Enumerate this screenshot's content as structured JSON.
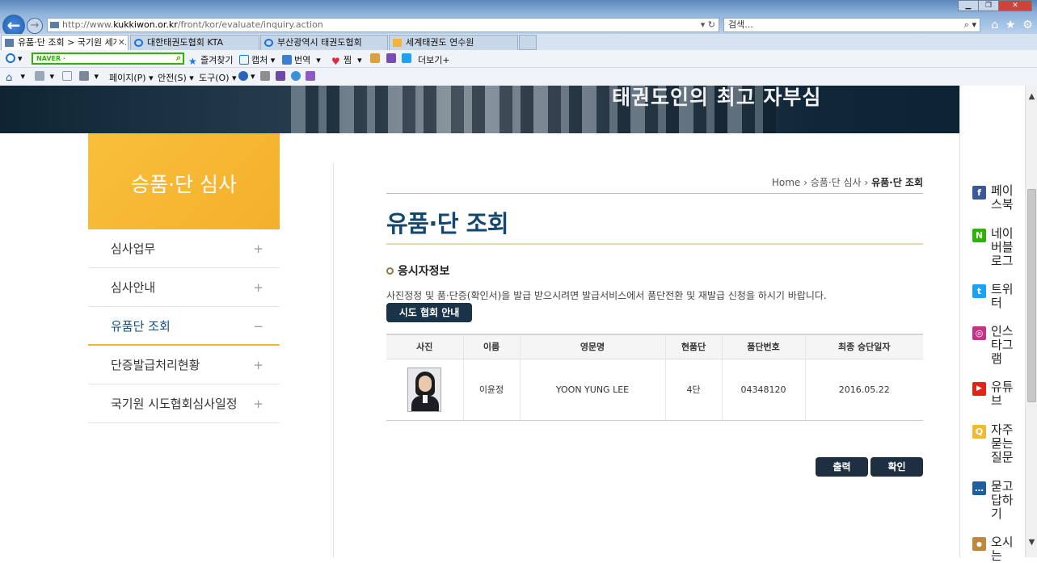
{
  "browser": {
    "address_prefix": "http://www.",
    "address_host": "kukkiwon.or.kr",
    "address_path": "/front/kor/evaluate/inquiry.action",
    "search_placeholder": "검색...",
    "tabs": [
      {
        "label": "유품·단 조회 > 국기원 세계..."
      },
      {
        "label": "대한태권도협회 KTA"
      },
      {
        "label": "부산광역시 태권도협회"
      },
      {
        "label": "세계태권도 연수원"
      }
    ],
    "toolbar1": {
      "naver_label": "NAVER ·",
      "favorites": "즐겨찾기",
      "capture": "캡처",
      "translate": "번역",
      "bookmark": "찜",
      "more": "더보기+"
    },
    "toolbar2": {
      "page": "페이지(P)",
      "safety": "안전(S)",
      "tools": "도구(O)"
    }
  },
  "site": {
    "banner_slogan": "태권도인의 최고 자부심",
    "left_header": "승품·단 심사",
    "left_menu": [
      {
        "label": "심사업무",
        "toggle": "+"
      },
      {
        "label": "심사안내",
        "toggle": "+"
      },
      {
        "label": "유품단 조회",
        "toggle": "−"
      },
      {
        "label": "단증발급처리현황",
        "toggle": "+"
      },
      {
        "label": "국기원 시도협회심사일정",
        "toggle": "+"
      }
    ],
    "breadcrumb": {
      "home": "Home",
      "parent": "승품·단 심사",
      "current": "유품·단 조회"
    },
    "page_title": "유품·단 조회",
    "section_title": "응시자정보",
    "notice": "사진정정 및 품·단증(확인서)을 발급 받으시려면 발급서비스에서 품단전환 및 재발급 신청을 하시기 바랍니다.",
    "org_button": "시도 협회 안내",
    "table": {
      "headers": [
        "사진",
        "이름",
        "영문명",
        "현품단",
        "품단번호",
        "최종 승단일자"
      ],
      "row": {
        "name": "이윤정",
        "english_name": "YOON YUNG LEE",
        "rank": "4단",
        "number": "04348120",
        "date": "2016.05.22"
      }
    },
    "print_button": "출력",
    "ok_button": "확인",
    "quick_links": [
      {
        "label": "페이스북",
        "icon": "facebook-icon",
        "color": "#3b5998",
        "glyph": "f"
      },
      {
        "label": "네이버블로그",
        "icon": "naver-blog-icon",
        "color": "#2db400",
        "glyph": "N"
      },
      {
        "label": "트위터",
        "icon": "twitter-icon",
        "color": "#1da1f2",
        "glyph": "t"
      },
      {
        "label": "인스타그램",
        "icon": "instagram-icon",
        "color": "#c13584",
        "glyph": "◎"
      },
      {
        "label": "유튜브",
        "icon": "youtube-icon",
        "color": "#e62117",
        "glyph": "▶"
      },
      {
        "label": "자주묻는질문",
        "icon": "faq-icon",
        "color": "#f5b82e",
        "glyph": "Q"
      },
      {
        "label": "묻고답하기",
        "icon": "qna-icon",
        "color": "#1f5f9c",
        "glyph": "…"
      },
      {
        "label": "오시는",
        "icon": "location-icon",
        "color": "#c0873e",
        "glyph": "●"
      }
    ]
  },
  "colors": {
    "accent": "#f4b02c",
    "title": "#12476f",
    "button": "#1b3349"
  }
}
